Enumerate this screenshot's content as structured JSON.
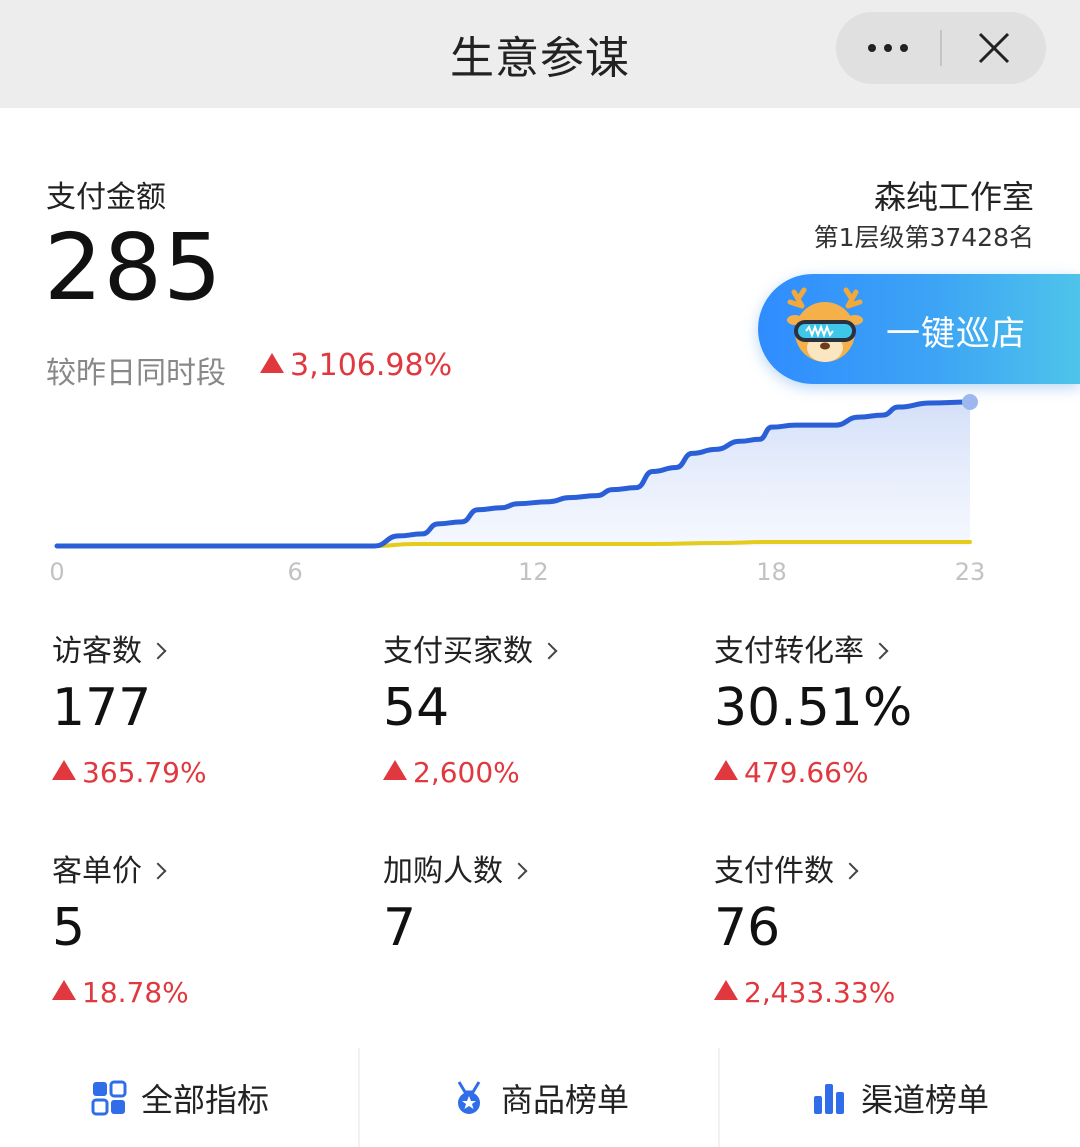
{
  "header": {
    "title": "生意参谋"
  },
  "icons": {
    "more": "more-icon",
    "close": "close-icon"
  },
  "summary": {
    "label": "支付金额",
    "value": "285",
    "compare_label": "较昨日同时段",
    "change": "3,106.98%"
  },
  "shop": {
    "name": "森纯工作室",
    "rank": "第1层级第37428名"
  },
  "patrol_button": {
    "label": "一键巡店"
  },
  "colors": {
    "today_line": "#2a5fd8",
    "yesterday_line": "#e3cc1c",
    "increase": "#e0383e",
    "accent": "#3d95f4"
  },
  "chart_data": {
    "type": "line",
    "x_ticks": [
      "0",
      "6",
      "12",
      "18",
      "23"
    ],
    "x_range": [
      0,
      23
    ],
    "series": [
      {
        "values": [
          [
            0,
            0
          ],
          [
            8,
            0
          ],
          [
            8.6,
            10
          ],
          [
            9.2,
            12
          ],
          [
            9.6,
            22
          ],
          [
            10.2,
            24
          ],
          [
            10.6,
            36
          ],
          [
            11.2,
            38
          ],
          [
            11.6,
            42
          ],
          [
            12.4,
            44
          ],
          [
            12.9,
            48
          ],
          [
            13.6,
            50
          ],
          [
            14,
            56
          ],
          [
            14.6,
            58
          ],
          [
            15,
            74
          ],
          [
            15.6,
            78
          ],
          [
            16,
            92
          ],
          [
            16.6,
            96
          ],
          [
            17.2,
            104
          ],
          [
            17.7,
            106
          ],
          [
            18,
            118
          ],
          [
            18.6,
            120
          ],
          [
            19.6,
            120
          ],
          [
            20.2,
            128
          ],
          [
            20.8,
            130
          ],
          [
            21.2,
            138
          ],
          [
            22,
            142
          ],
          [
            23,
            143
          ]
        ]
      },
      {
        "values": [
          [
            0,
            0
          ],
          [
            8,
            0
          ],
          [
            9,
            2
          ],
          [
            12,
            2
          ],
          [
            15,
            2
          ],
          [
            16.6,
            3
          ],
          [
            18,
            4
          ],
          [
            23,
            4
          ]
        ]
      }
    ],
    "grid": false
  },
  "metrics": [
    {
      "label": "访客数",
      "value": "177",
      "change": "365.79%"
    },
    {
      "label": "支付买家数",
      "value": "54",
      "change": "2,600%"
    },
    {
      "label": "支付转化率",
      "value": "30.51%",
      "change": "479.66%"
    },
    {
      "label": "客单价",
      "value": "5",
      "change": "18.78%"
    },
    {
      "label": "加购人数",
      "value": "7",
      "change": ""
    },
    {
      "label": "支付件数",
      "value": "76",
      "change": "2,433.33%"
    }
  ],
  "bottom_nav": [
    {
      "label": "全部指标",
      "icon": "grid-icon"
    },
    {
      "label": "商品榜单",
      "icon": "medal-icon"
    },
    {
      "label": "渠道榜单",
      "icon": "bar-chart-icon"
    }
  ]
}
